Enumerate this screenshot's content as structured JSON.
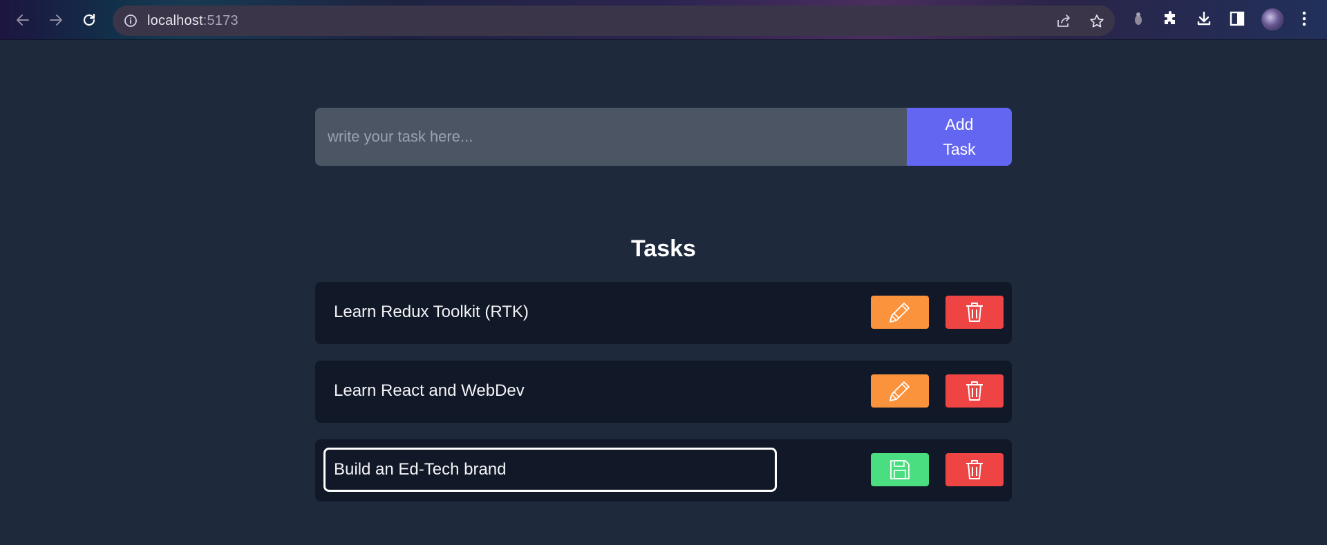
{
  "browser": {
    "url_host": "localhost",
    "url_port": ":5173"
  },
  "form": {
    "placeholder": "write your task here...",
    "value": "",
    "add_button_label": "Add Task"
  },
  "tasks_heading": "Tasks",
  "tasks": [
    {
      "text": "Learn Redux Toolkit (RTK)",
      "editing": false
    },
    {
      "text": "Learn React and WebDev",
      "editing": false
    },
    {
      "text": "Build an Ed-Tech brand",
      "editing": true
    }
  ],
  "colors": {
    "page_bg": "#1e293b",
    "task_bg": "#111827",
    "input_bg": "#4b5563",
    "add_button": "#6366f1",
    "edit_button": "#fb923c",
    "delete_button": "#ef4444",
    "save_button": "#4ade80"
  },
  "icons": {
    "back": "arrow-left-icon",
    "forward": "arrow-right-icon",
    "reload": "reload-icon",
    "site_info": "info-icon",
    "share": "share-icon",
    "bookmark": "star-icon",
    "extension_dot": "extension-icon",
    "extensions": "puzzle-icon",
    "downloads": "download-icon",
    "side_panel": "side-panel-icon",
    "menu": "kebab-menu-icon",
    "edit": "pencil-icon",
    "delete": "trash-icon",
    "save": "floppy-disk-icon"
  }
}
